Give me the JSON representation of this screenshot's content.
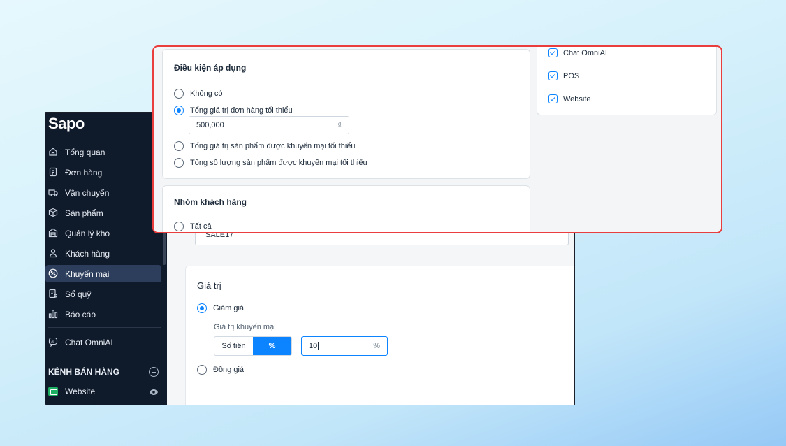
{
  "sidebar": {
    "logo": "Sapo",
    "items": [
      {
        "label": "Tổng quan",
        "icon": "home-icon"
      },
      {
        "label": "Đơn hàng",
        "icon": "order-icon"
      },
      {
        "label": "Vận chuyển",
        "icon": "truck-icon"
      },
      {
        "label": "Sản phẩm",
        "icon": "box-icon"
      },
      {
        "label": "Quản lý kho",
        "icon": "warehouse-icon"
      },
      {
        "label": "Khách hàng",
        "icon": "user-icon"
      },
      {
        "label": "Khuyến mại",
        "icon": "discount-icon",
        "active": true
      },
      {
        "label": "Sổ quỹ",
        "icon": "cashbook-icon"
      },
      {
        "label": "Báo cáo",
        "icon": "report-icon"
      },
      {
        "label": "Chat OmniAI",
        "icon": "ai-chat-icon"
      }
    ],
    "sales_channels_heading": "KÊNH BÁN HÀNG",
    "channel_website": "Website"
  },
  "main": {
    "code_value": "SALE17",
    "value_section": {
      "title": "Giá trị",
      "option_discount": "Giảm giá",
      "promo_value_label": "Giá trị khuyến mại",
      "seg_amount": "Số tiền",
      "seg_percent": "%",
      "percent_value": "10",
      "percent_suffix": "%",
      "option_same_price": "Đồng giá"
    }
  },
  "zoom": {
    "conditions": {
      "title": "Điều kiện áp dụng",
      "options": [
        "Không có",
        "Tổng giá trị đơn hàng tối thiểu",
        "Tổng giá trị sản phẩm được khuyến mại tối thiểu",
        "Tổng số lượng sản phẩm được khuyến mại tối thiểu"
      ],
      "selected_index": 1,
      "min_amount": "500,000",
      "currency": "₫"
    },
    "customer_group": {
      "title": "Nhóm khách hàng",
      "option_all": "Tất cả"
    },
    "channels": [
      "Chat OmniAI",
      "POS",
      "Website"
    ]
  },
  "colors": {
    "accent": "#0d84ff",
    "highlight_border": "#ea3d3d",
    "sidebar_bg": "#0f1a2a",
    "active_item_bg": "#2c3e5c"
  }
}
